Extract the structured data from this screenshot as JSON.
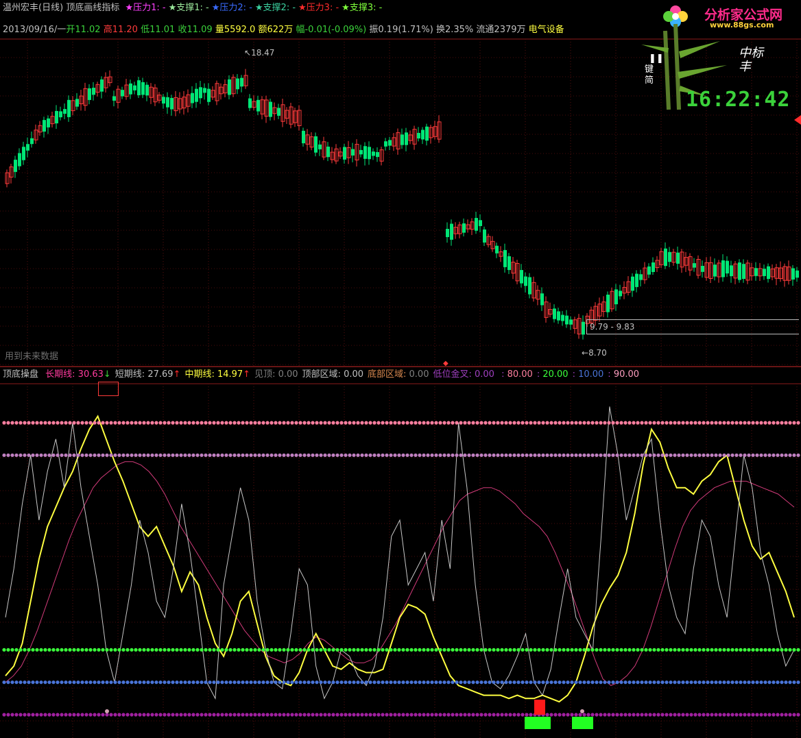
{
  "header": {
    "stock_name": "温州宏丰",
    "period": "(日线)",
    "indicator": "顶底画线指标",
    "legend": [
      {
        "label": "压力1:",
        "value": "-",
        "color": "#ff40ff"
      },
      {
        "label": "支撑1:",
        "value": "-",
        "color": "#9be89b"
      },
      {
        "label": "压力2:",
        "value": "-",
        "color": "#3a6bff"
      },
      {
        "label": "支撑2:",
        "value": "-",
        "color": "#3bd2a0"
      },
      {
        "label": "压力3:",
        "value": "-",
        "color": "#ff2b2b"
      },
      {
        "label": "支撑3:",
        "value": "-",
        "color": "#7fff3b"
      }
    ]
  },
  "quote": {
    "date": "2013/09/16/一",
    "open_label": "开",
    "open": "11.02",
    "high_label": "高",
    "high": "11.20",
    "low_label": "低",
    "low": "11.01",
    "close_label": "收",
    "close": "11.09",
    "volume_label": "量",
    "volume": "5592.0",
    "amount_label": "额",
    "amount": "622万",
    "change_label": "幅",
    "change": "-0.01(-0.09%)",
    "amplitude_label": "振",
    "amplitude": "0.19(1.71%)",
    "turnover_label": "换",
    "turnover": "2.35%",
    "float_label": "流通",
    "float": "2379万",
    "sector": "电气设备"
  },
  "price_panel": {
    "high_marker": "18.47",
    "low_marker": "8.70",
    "range_box": "9.79 - 9.83",
    "future_notice": "用到未来数据"
  },
  "indicator_panel": {
    "name": "顶底操盘",
    "items": [
      {
        "label": "长期线:",
        "value": "30.63",
        "arrow": "↓",
        "label_color": "#ff3b9e",
        "value_color": "#ff3b9e",
        "arrow_color": "#3bd23b"
      },
      {
        "label": "短期线:",
        "value": "27.69",
        "arrow": "↑",
        "label_color": "#c0c0c0",
        "value_color": "#c0c0c0",
        "arrow_color": "#ff2b2b"
      },
      {
        "label": "中期线:",
        "value": "14.97",
        "arrow": "↑",
        "label_color": "#ffff40",
        "value_color": "#ffff40",
        "arrow_color": "#ff2b2b"
      },
      {
        "label": "见顶:",
        "value": "0.00",
        "arrow": "",
        "label_color": "#808080",
        "value_color": "#808080",
        "arrow_color": "#808080"
      },
      {
        "label": "顶部区域:",
        "value": "0.00",
        "arrow": "",
        "label_color": "#c0c0c0",
        "value_color": "#c0c0c0",
        "arrow_color": "#c0c0c0"
      },
      {
        "label": "底部区域:",
        "value": "0.00",
        "arrow": "",
        "label_color": "#d7874e",
        "value_color": "#808080",
        "arrow_color": "#808080"
      },
      {
        "label": "低位金叉:",
        "value": "0.00",
        "arrow": "",
        "label_color": "#a040c0",
        "value_color": "#a040c0",
        "arrow_color": "#a040c0"
      }
    ],
    "levels": [
      {
        "value": "80.00",
        "color": "#ff7f9e"
      },
      {
        "value": "20.00",
        "color": "#3bff3b"
      },
      {
        "value": "10.00",
        "color": "#4a74d8"
      },
      {
        "value": "90.00",
        "color": "#ff9ec0"
      }
    ]
  },
  "logo": {
    "text": "分析家公式网",
    "url": "www.88gs.com"
  },
  "widget": {
    "time": "16:22:42",
    "left_text": "键简",
    "right_text": "中标丰",
    "pause_icon": "pause-icon"
  },
  "colors": {
    "up": "#ff3b3b",
    "down": "#00e676",
    "grid": "#7a1010",
    "long_line": "#d23b7a",
    "mid_line": "#ffff40",
    "short_line": "#c8c8c8"
  },
  "chart_data": [
    {
      "type": "candlestick",
      "title": "温州宏丰 (日线)",
      "annotations": {
        "max": 18.47,
        "min": 8.7
      },
      "range_box": [
        9.79,
        9.83
      ]
    },
    {
      "type": "line",
      "title": "顶底操盘",
      "ylim": [
        0,
        100
      ],
      "hlines": [
        90,
        80,
        20,
        10,
        0
      ],
      "series": [
        {
          "name": "长期线",
          "color": "#d23b7a",
          "values": [
            10,
            12,
            15,
            20,
            26,
            33,
            40,
            47,
            54,
            60,
            65,
            70,
            73,
            75,
            77,
            78,
            78,
            77,
            75,
            72,
            68,
            63,
            58,
            54,
            50,
            46,
            42,
            38,
            34,
            30,
            26,
            23,
            20,
            18,
            17,
            16,
            17,
            19,
            22,
            24,
            23,
            21,
            19,
            17,
            16,
            16,
            17,
            20,
            24,
            28,
            33,
            38,
            43,
            48,
            53,
            58,
            62,
            66,
            68,
            69,
            70,
            70,
            69,
            67,
            65,
            62,
            60,
            58,
            55,
            50,
            44,
            38,
            31,
            24,
            17,
            11,
            9,
            10,
            12,
            15,
            20,
            27,
            35,
            43,
            51,
            58,
            63,
            66,
            68,
            70,
            71,
            72,
            72,
            72,
            71,
            70,
            69,
            68,
            66,
            64
          ]
        },
        {
          "name": "中期线",
          "color": "#ffff40",
          "values": [
            12,
            15,
            22,
            35,
            48,
            58,
            64,
            70,
            75,
            82,
            88,
            92,
            85,
            78,
            72,
            65,
            58,
            55,
            58,
            52,
            46,
            38,
            44,
            40,
            30,
            22,
            18,
            25,
            35,
            38,
            28,
            18,
            12,
            10,
            9,
            13,
            20,
            25,
            20,
            15,
            14,
            16,
            14,
            13,
            13,
            14,
            22,
            30,
            34,
            33,
            31,
            24,
            18,
            12,
            9,
            8,
            7,
            6,
            6,
            6,
            5,
            6,
            5,
            5,
            6,
            5,
            4,
            6,
            10,
            18,
            27,
            34,
            39,
            43,
            50,
            62,
            77,
            88,
            84,
            76,
            70,
            70,
            68,
            72,
            74,
            78,
            80,
            70,
            60,
            52,
            48,
            50,
            44,
            38,
            30
          ]
        },
        {
          "name": "短期线",
          "color": "#c8c8c8",
          "values": [
            30,
            45,
            65,
            80,
            60,
            75,
            85,
            70,
            90,
            70,
            55,
            40,
            20,
            10,
            25,
            40,
            60,
            50,
            35,
            30,
            45,
            65,
            50,
            30,
            10,
            5,
            40,
            55,
            70,
            60,
            35,
            20,
            10,
            8,
            25,
            45,
            40,
            15,
            5,
            10,
            20,
            18,
            12,
            9,
            15,
            30,
            55,
            60,
            40,
            45,
            50,
            35,
            60,
            45,
            90,
            70,
            40,
            20,
            10,
            8,
            12,
            18,
            25,
            10,
            6,
            14,
            30,
            45,
            30,
            25,
            20,
            55,
            95,
            80,
            60,
            70,
            80,
            85,
            60,
            40,
            30,
            25,
            45,
            60,
            55,
            40,
            30,
            55,
            80,
            70,
            50,
            40,
            25,
            15,
            20
          ]
        }
      ]
    }
  ]
}
